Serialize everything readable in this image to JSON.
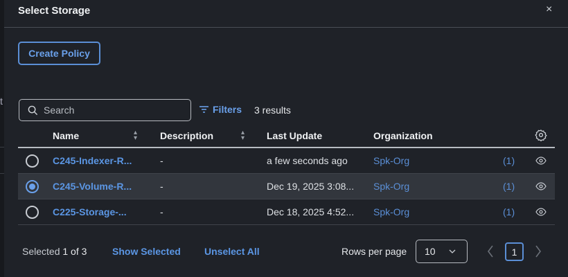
{
  "backdrop": {
    "partial_text": "t"
  },
  "dialog": {
    "title": "Select Storage",
    "close": "×"
  },
  "create_policy": "Create Policy",
  "search": {
    "placeholder": "Search",
    "value": ""
  },
  "filters": "Filters",
  "results": "3 results",
  "columns": [
    "Name",
    "Description",
    "Last Update",
    "Organization"
  ],
  "rows": [
    {
      "name": "C245-Indexer-R...",
      "description": "-",
      "last_update": "a few seconds ago",
      "organization": "Spk-Org",
      "count": "(1)",
      "selected": false
    },
    {
      "name": "C245-Volume-R...",
      "description": "-",
      "last_update": "Dec 19, 2025 3:08...",
      "organization": "Spk-Org",
      "count": "(1)",
      "selected": true
    },
    {
      "name": "C225-Storage-...",
      "description": "-",
      "last_update": "Dec 18, 2025 4:52...",
      "organization": "Spk-Org",
      "count": "(1)",
      "selected": false
    }
  ],
  "footer": {
    "selected_label": "Selected",
    "selected_count": "1 of 3",
    "show_selected": "Show Selected",
    "unselect_all": "Unselect All",
    "rows_per_page": "Rows per page",
    "rows_value": "10",
    "page": "1"
  },
  "colors": {
    "accent": "#5b8fd6",
    "panel": "#1f2228"
  }
}
